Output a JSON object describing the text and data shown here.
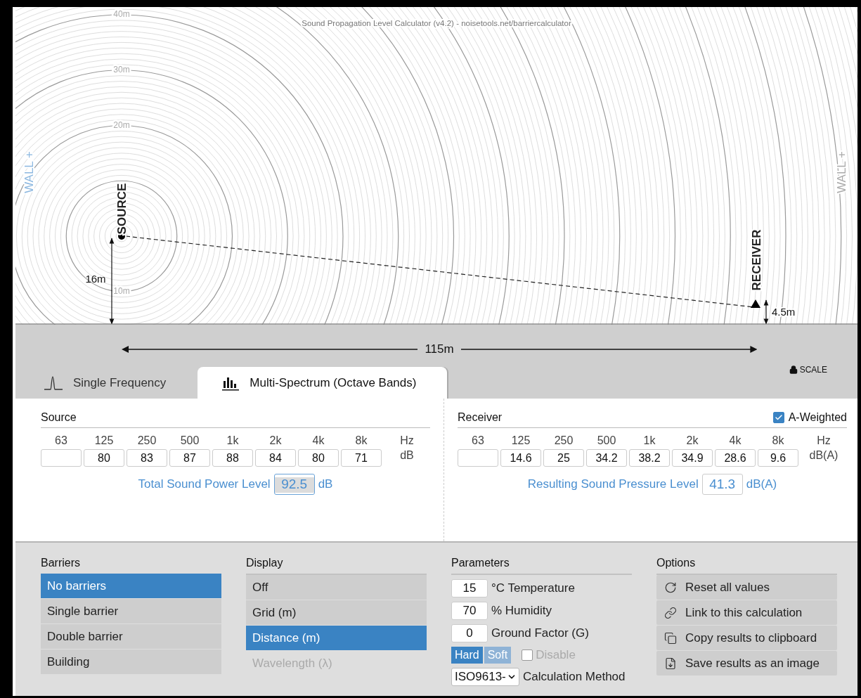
{
  "canvas": {
    "title": "Sound Propagation Level Calculator (v4.2) - noisetools.net/barriercalculator",
    "distance_labels": [
      "40m",
      "30m",
      "20m",
      "10m"
    ],
    "walls": [
      {
        "label": "WALL +"
      },
      {
        "label": "WALL +"
      }
    ],
    "source": {
      "label": "SOURCE",
      "height": "16m"
    },
    "receiver": {
      "label": "RECEIVER",
      "height": "4.5m"
    },
    "distance": "115m",
    "scale": {
      "label": "SCALE",
      "locked": true
    }
  },
  "tabs": [
    {
      "label": "Single Frequency",
      "selected": false
    },
    {
      "label": "Multi-Spectrum (Octave Bands)",
      "selected": true
    }
  ],
  "source_panel": {
    "title": "Source",
    "unit_row": "Hz",
    "unit": "dB",
    "cells": [
      {
        "band": "63"
      },
      {
        "band": "125",
        "value": "80"
      },
      {
        "band": "250",
        "value": "83"
      },
      {
        "band": "500",
        "value": "87"
      },
      {
        "band": "1k",
        "value": "88"
      },
      {
        "band": "2k",
        "value": "84"
      },
      {
        "band": "4k",
        "value": "80"
      },
      {
        "band": "8k",
        "value": "71"
      }
    ],
    "total_label": "Total Sound Power Level",
    "total": "92.5",
    "total_unit": "dB",
    "total_focused": true
  },
  "receiver_panel": {
    "title": "Receiver",
    "weighting": {
      "label": "A-Weighted",
      "checked": true
    },
    "unit_row": "Hz",
    "unit": "dB(A)",
    "cells": [
      {
        "band": "63"
      },
      {
        "band": "125",
        "value": "14.6"
      },
      {
        "band": "250",
        "value": "25"
      },
      {
        "band": "500",
        "value": "34.2"
      },
      {
        "band": "1k",
        "value": "38.2"
      },
      {
        "band": "2k",
        "value": "34.9"
      },
      {
        "band": "4k",
        "value": "28.6"
      },
      {
        "band": "8k",
        "value": "9.6"
      }
    ],
    "total_label": "Resulting Sound Pressure Level",
    "total": "41.3",
    "total_unit": "dB(A)",
    "total_focused": false
  },
  "barriers": {
    "title": "Barriers",
    "items": [
      {
        "label": "No barriers",
        "selected": true
      },
      {
        "label": "Single barrier",
        "selected": false
      },
      {
        "label": "Double barrier",
        "selected": false
      },
      {
        "label": "Building",
        "selected": false
      }
    ]
  },
  "display": {
    "title": "Display",
    "items": [
      {
        "label": "Off",
        "selected": false,
        "disabled": false
      },
      {
        "label": "Grid (m)",
        "selected": false,
        "disabled": false
      },
      {
        "label": "Distance (m)",
        "selected": true,
        "disabled": false
      },
      {
        "label": "Wavelength (λ)",
        "selected": false,
        "disabled": true
      }
    ]
  },
  "parameters": {
    "title": "Parameters",
    "fields": [
      {
        "value": "15",
        "label": "°C Temperature"
      },
      {
        "value": "70",
        "label": "% Humidity"
      },
      {
        "value": "0",
        "label": "Ground Factor (G)"
      }
    ],
    "ground": [
      {
        "label": "Hard",
        "selected": true
      },
      {
        "label": "Soft",
        "selected": false
      }
    ],
    "disable": {
      "label": "Disable",
      "checked": false
    },
    "method": {
      "value": "ISO9613-",
      "label": "Calculation Method"
    }
  },
  "options": {
    "title": "Options",
    "items": [
      {
        "label": "Reset all values",
        "kind": "reset"
      },
      {
        "label": "Link to this calculation",
        "kind": "link"
      },
      {
        "label": "Copy results to clipboard",
        "kind": "copy"
      },
      {
        "label": "Save results as an image",
        "kind": "save"
      }
    ]
  }
}
